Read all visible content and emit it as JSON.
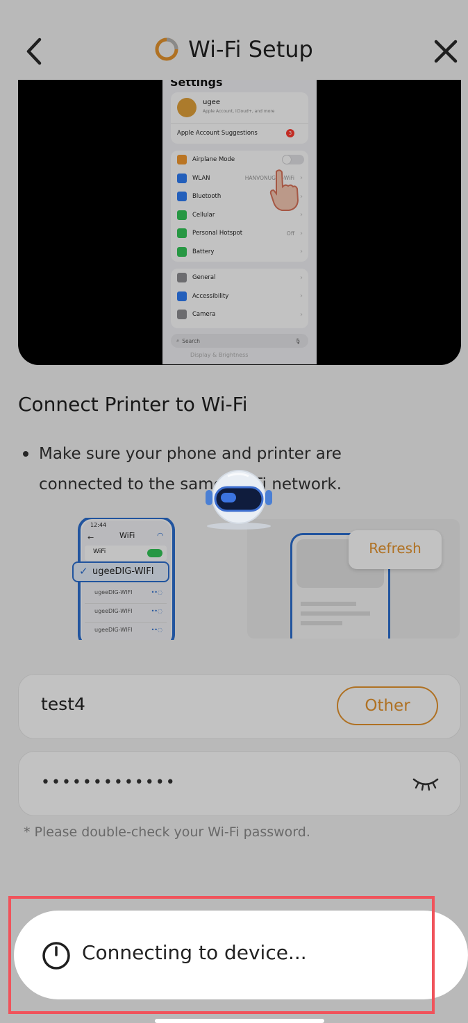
{
  "header": {
    "title": "Wi-Fi Setup",
    "back_icon": "chevron-left-icon",
    "close_icon": "close-icon",
    "accent": "#e6952f"
  },
  "video": {
    "settings_title": "Settings",
    "account_name": "ugee",
    "account_sub": "Apple Account, iCloud+, and more",
    "suggestions_label": "Apple Account Suggestions",
    "suggestions_badge": "3",
    "rows": [
      {
        "label": "Airplane Mode",
        "value": "",
        "icon_color": "#f59a2f"
      },
      {
        "label": "WLAN",
        "value": "HANVONUGEE-WiFi",
        "icon_color": "#2f7df6"
      },
      {
        "label": "Bluetooth",
        "value": "",
        "icon_color": "#2f7df6"
      },
      {
        "label": "Cellular",
        "value": "",
        "icon_color": "#34c759"
      },
      {
        "label": "Personal Hotspot",
        "value": "Off",
        "icon_color": "#34c759"
      },
      {
        "label": "Battery",
        "value": "",
        "icon_color": "#34c759"
      }
    ],
    "rows2": [
      {
        "label": "General",
        "icon_color": "#8e8e93"
      },
      {
        "label": "Accessibility",
        "icon_color": "#2f7df6"
      },
      {
        "label": "Camera",
        "icon_color": "#8e8e93"
      }
    ],
    "search_placeholder": "Search",
    "faded_row": "Display & Brightness"
  },
  "section": {
    "heading": "Connect Printer to Wi-Fi",
    "bullet": "Make sure your phone and printer are connected to the same Wi-Fi network."
  },
  "illustration": {
    "phone_time": "12:44",
    "phone_title": "WiFi",
    "wifi_label": "WiFi",
    "selected_network": "ugeeDIG-WIFI",
    "networks": [
      "ugeeDIG-WIFI",
      "ugeeDIG-WIFI",
      "ugeeDIG-WIFI"
    ],
    "refresh_label": "Refresh"
  },
  "form": {
    "ssid": "test4",
    "other_label": "Other",
    "password_masked": "•••••••••••••",
    "eye_icon": "eye-closed-icon",
    "hint": "* Please double-check your Wi-Fi password."
  },
  "toast": {
    "text": "Connecting to device...",
    "icon": "spinner-icon"
  }
}
